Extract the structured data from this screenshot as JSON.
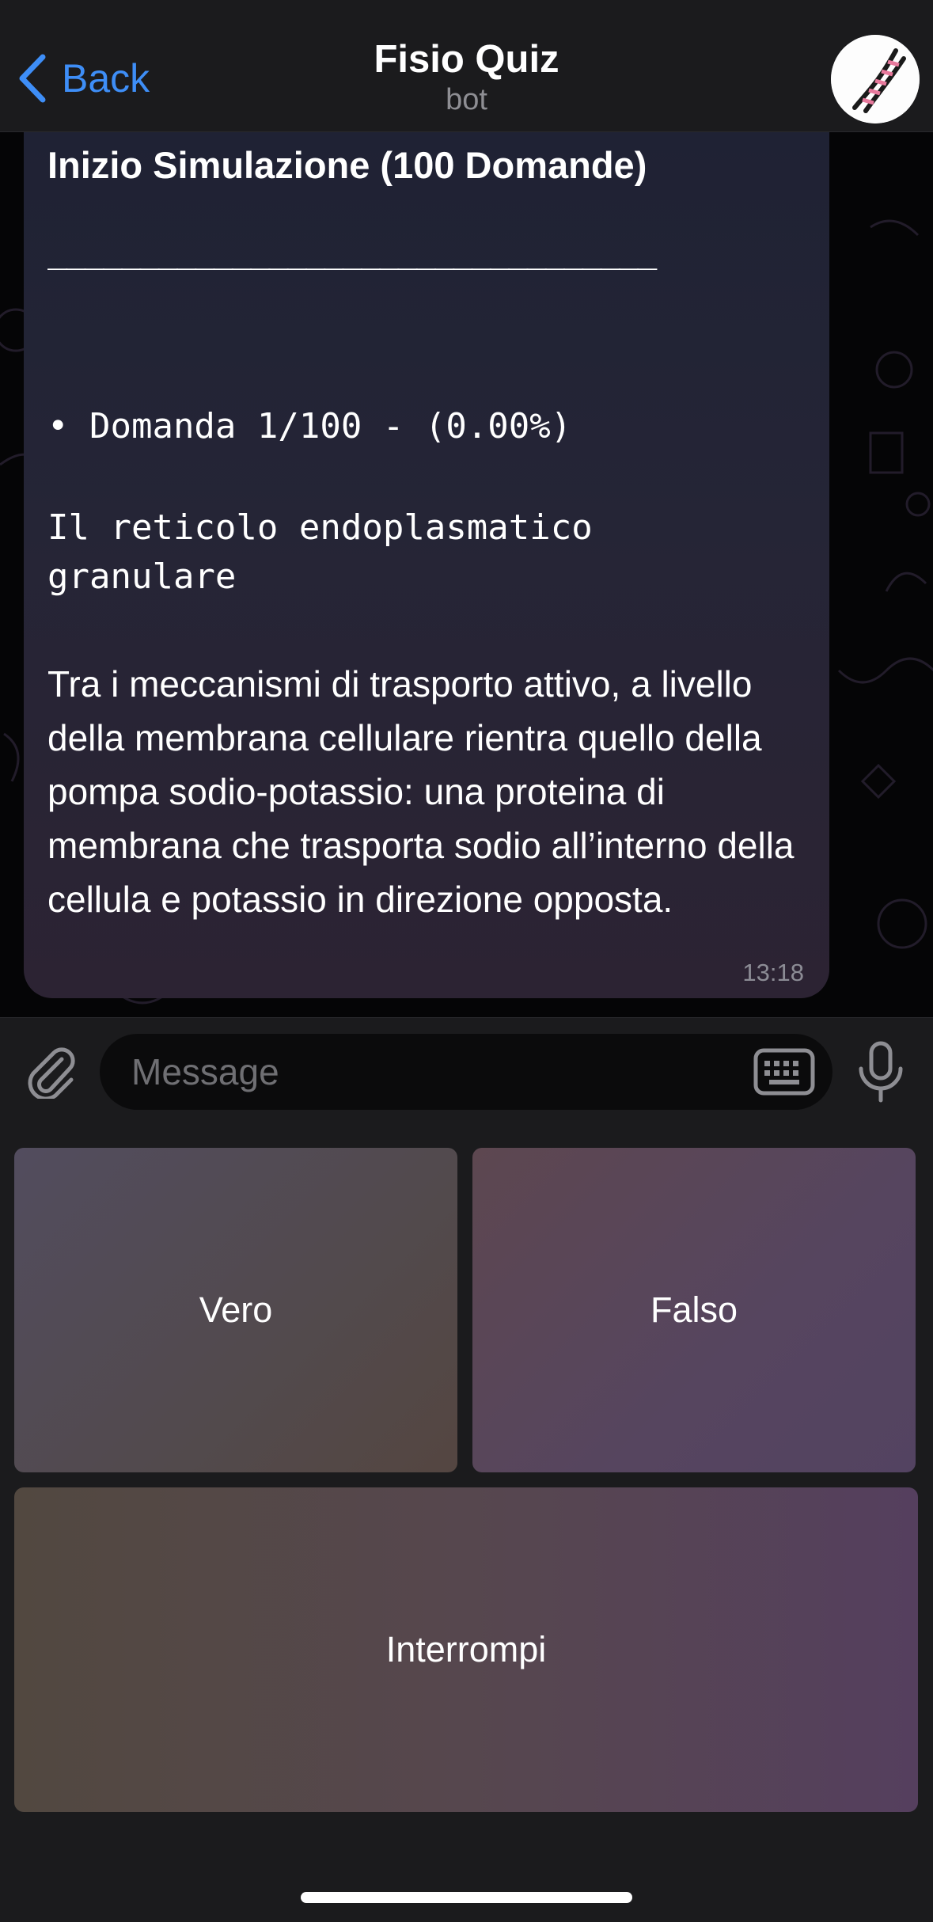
{
  "header": {
    "back_label": "Back",
    "title": "Fisio Quiz",
    "subtitle": "bot",
    "avatar_icon": "dna-icon"
  },
  "message": {
    "title": "Inizio Simulazione (100 Domande)",
    "separator": "_________________________________",
    "question_line": "• Domanda 1/100 - (0.00%)",
    "topic": "Il reticolo endoplasmatico granulare",
    "body": "Tra i meccanismi di trasporto attivo, a livello della membrana cellulare rientra quello della pompa sodio-potassio: una proteina di membrana che trasporta sodio all’interno della cellula e potassio in direzione opposta.",
    "time": "13:18"
  },
  "composer": {
    "placeholder": "Message",
    "attach_icon": "paperclip-icon",
    "keyboard_icon": "keyboard-icon",
    "mic_icon": "microphone-icon"
  },
  "reply_keyboard": {
    "buttons": [
      "Vero",
      "Falso",
      "Interrompi"
    ]
  },
  "colors": {
    "accent": "#3e8ef7",
    "bar_background": "#1b1b1d",
    "timestamp": "#8c8c95"
  }
}
